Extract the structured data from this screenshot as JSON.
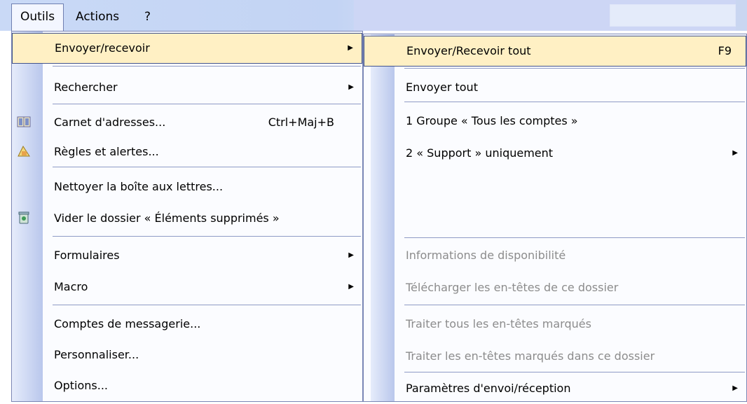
{
  "menubar": {
    "items": [
      {
        "label": "Outils",
        "key": "O"
      },
      {
        "label": "Actions",
        "key": "s"
      },
      {
        "label": "?",
        "key": "?"
      }
    ]
  },
  "outils_menu": {
    "items": [
      {
        "label": "Envoyer/recevoir",
        "shortcut": "",
        "submenu": true,
        "highlighted": true,
        "icon": ""
      },
      {
        "label": "Rechercher",
        "shortcut": "",
        "submenu": true,
        "icon": ""
      },
      {
        "label": "Carnet d'adresses...",
        "shortcut": "Ctrl+Maj+B",
        "submenu": false,
        "icon": "address-book-icon"
      },
      {
        "label": "Règles et alertes...",
        "shortcut": "",
        "submenu": false,
        "icon": "rules-icon"
      },
      {
        "label": "Nettoyer la boîte aux lettres...",
        "shortcut": "",
        "submenu": false,
        "icon": ""
      },
      {
        "label": "Vider le dossier « Éléments supprimés »",
        "shortcut": "",
        "submenu": false,
        "icon": "trash-icon"
      },
      {
        "label": "Formulaires",
        "shortcut": "",
        "submenu": true,
        "icon": ""
      },
      {
        "label": "Macro",
        "shortcut": "",
        "submenu": true,
        "icon": ""
      },
      {
        "label": "Comptes de messagerie...",
        "shortcut": "",
        "submenu": false,
        "icon": ""
      },
      {
        "label": "Personnaliser...",
        "shortcut": "",
        "submenu": false,
        "icon": ""
      },
      {
        "label": "Options...",
        "shortcut": "",
        "submenu": false,
        "icon": ""
      }
    ]
  },
  "send_receive_submenu": {
    "items": [
      {
        "label": "Envoyer/Recevoir tout",
        "shortcut": "F9",
        "submenu": false,
        "disabled": false,
        "highlighted": true
      },
      {
        "label": "Envoyer tout",
        "shortcut": "",
        "submenu": false,
        "disabled": false
      },
      {
        "label": "1 Groupe « Tous les comptes »",
        "shortcut": "",
        "submenu": false,
        "disabled": false
      },
      {
        "label": "2 « Support » uniquement",
        "shortcut": "",
        "submenu": true,
        "disabled": false
      },
      {
        "label": "Informations de disponibilité",
        "shortcut": "",
        "submenu": false,
        "disabled": true
      },
      {
        "label": "Télécharger les en-têtes de ce dossier",
        "shortcut": "",
        "submenu": false,
        "disabled": true
      },
      {
        "label": "Traiter tous les en-têtes marqués",
        "shortcut": "",
        "submenu": false,
        "disabled": true
      },
      {
        "label": "Traiter les en-têtes marqués dans ce dossier",
        "shortcut": "",
        "submenu": false,
        "disabled": true
      },
      {
        "label": "Paramètres d'envoi/réception",
        "shortcut": "",
        "submenu": true,
        "disabled": false
      }
    ]
  },
  "colors": {
    "menubar": "#c9d9f6",
    "highlight": "#fff0c4",
    "highlight_border": "#41538c",
    "disabled_text": "#8c8c8c",
    "rail": "#b9c7ec"
  }
}
